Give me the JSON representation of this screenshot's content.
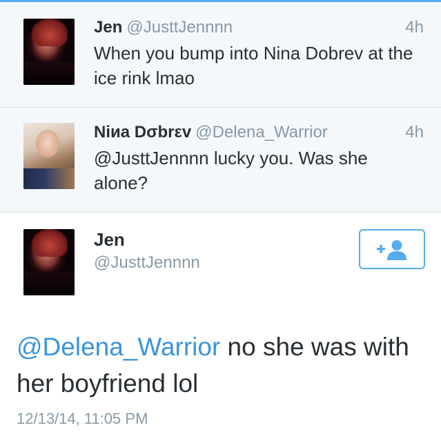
{
  "accent_color": "#55acee",
  "link_color": "#3b94d9",
  "context_tweets": [
    {
      "name": "Jen",
      "handle": "@JusttJennnn",
      "time": "4h",
      "text": "When you bump into Nina Dobrev at the ice rink lmao"
    },
    {
      "name": "Niиa Dσbrεv",
      "handle": "@Delena_Warrior",
      "time": "4h",
      "text": "@JusttJennnn lucky you. Was she alone?"
    }
  ],
  "main_tweet": {
    "name": "Jen",
    "handle": "@JusttJennnn",
    "follow_icon": "add-user-icon",
    "mention": "@Delena_Warrior",
    "text": " no she was with her boyfriend lol",
    "timestamp": "12/13/14, 11:05 PM"
  }
}
